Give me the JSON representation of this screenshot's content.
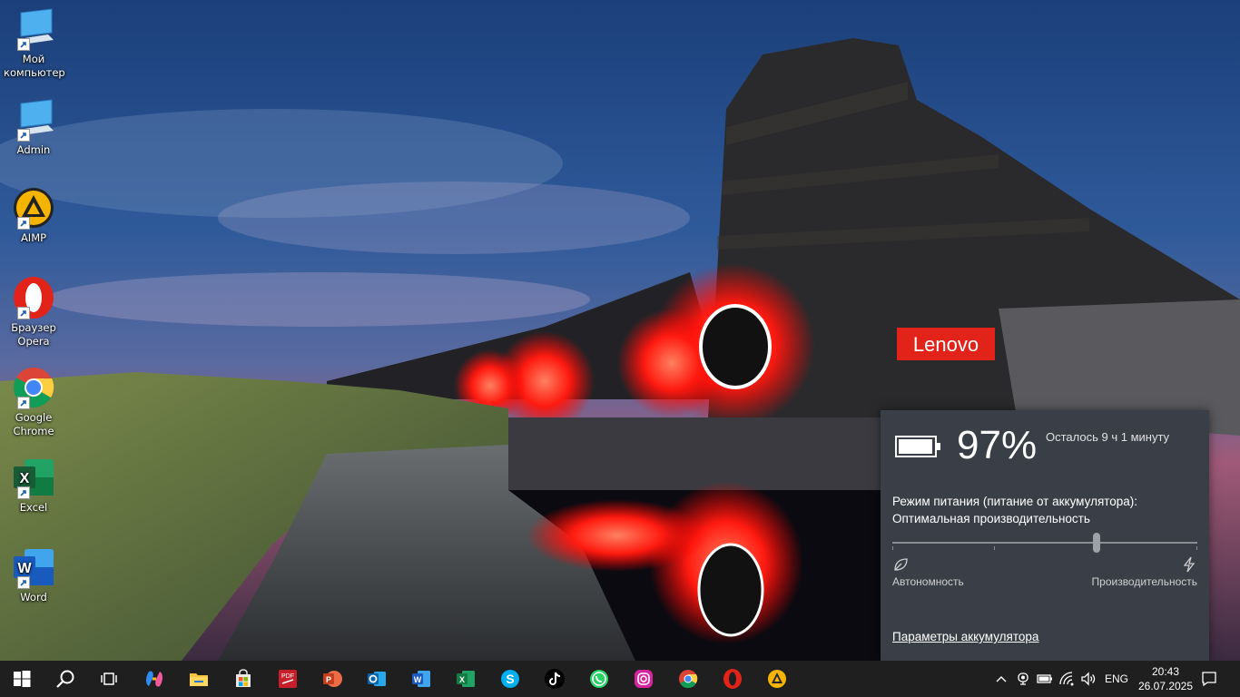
{
  "desktop": {
    "icons": [
      {
        "label": "Мой компьютер",
        "icon": "computer-icon"
      },
      {
        "label": "Admin",
        "icon": "computer-icon"
      },
      {
        "label": "AIMP",
        "icon": "aimp-icon"
      },
      {
        "label": "Браузер Opera",
        "icon": "opera-icon"
      },
      {
        "label": "Google Chrome",
        "icon": "chrome-icon"
      },
      {
        "label": "Excel",
        "icon": "excel-icon"
      },
      {
        "label": "Word",
        "icon": "word-icon"
      }
    ],
    "brand_logo": "Lenovo"
  },
  "battery_flyout": {
    "percent": "97%",
    "remaining": "Осталось 9 ч 1 минуту",
    "mode_label": "Режим питания (питание от аккумулятора):",
    "mode_value": "Оптимальная производительность",
    "slider_left_label": "Автономность",
    "slider_right_label": "Производительность",
    "slider_position_fraction": 0.67,
    "settings_link": "Параметры аккумулятора",
    "battery_level_fraction": 0.97
  },
  "taskbar": {
    "apps": [
      "start",
      "search",
      "task-view",
      "copilot",
      "file-explorer",
      "store",
      "pdf",
      "powerpoint",
      "outlook",
      "word",
      "excel",
      "skype",
      "tiktok",
      "whatsapp",
      "instagram",
      "chrome",
      "opera",
      "aimp"
    ],
    "language": "ENG",
    "time": "20:43",
    "date": "26.07.2025"
  },
  "colors": {
    "flyout_bg": "#3a3f47",
    "taskbar_bg": "#1f1f1f",
    "lenovo_red": "#e2231a"
  }
}
